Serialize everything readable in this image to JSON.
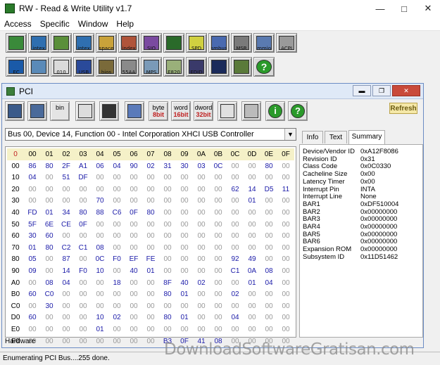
{
  "app": {
    "title": "RW - Read & Write Utility v1.7"
  },
  "menu": [
    "Access",
    "Specific",
    "Window",
    "Help"
  ],
  "toolbar_main": [
    {
      "label": "",
      "icon": "memory-chip-icon"
    },
    {
      "label": "intex",
      "icon": "intex-chip-icon"
    },
    {
      "label": "",
      "icon": "memory-module-icon"
    },
    {
      "label": "intex",
      "icon": "intex-memory-icon"
    },
    {
      "label": "space",
      "icon": "io-space-icon"
    },
    {
      "label": "index",
      "icon": "io-index-icon"
    },
    {
      "label": "SIO",
      "icon": "superio-icon"
    },
    {
      "label": "",
      "icon": "oscilloscope-icon"
    },
    {
      "label": "SPD",
      "icon": "spd-icon"
    },
    {
      "label": "smbus",
      "icon": "smbus-icon"
    },
    {
      "label": "MSR",
      "icon": "msr-icon"
    },
    {
      "label": "mmio",
      "icon": "mmio-icon"
    },
    {
      "label": "ACPI",
      "icon": "acpi-icon"
    },
    {
      "label": "EC",
      "icon": "ec-icon"
    },
    {
      "label": "",
      "icon": "disk-icon"
    },
    {
      "label": "010",
      "icon": "binary-icon"
    },
    {
      "label": "USB",
      "icon": "usb-icon"
    },
    {
      "label": "bios",
      "icon": "smbios-icon"
    },
    {
      "label": "55AA",
      "icon": "rom-icon"
    },
    {
      "label": "MPS",
      "icon": "mps-icon"
    },
    {
      "label": "E820",
      "icon": "e820-icon"
    },
    {
      "label": "EDID",
      "icon": "edid-icon"
    },
    {
      "label": "",
      "icon": "terminal-icon"
    },
    {
      "label": "",
      "icon": "phone-icon"
    },
    {
      "label": "",
      "icon": "help-icon"
    }
  ],
  "pci_window": {
    "title": "PCI",
    "refresh_label": "Refresh",
    "toolbar": [
      {
        "label": "",
        "icon": "save-icon"
      },
      {
        "label": "",
        "icon": "copy-icon"
      },
      {
        "label": "bin",
        "icon": "bin-icon"
      },
      {
        "label": "",
        "icon": "open-icon"
      },
      {
        "label": "",
        "icon": "binoculars-icon"
      },
      {
        "label": "",
        "icon": "grid-icon"
      },
      {
        "label": "byte 8bit",
        "icon": "byte-icon"
      },
      {
        "label": "word 16bit",
        "icon": "word-icon"
      },
      {
        "label": "dword 32bit",
        "icon": "dword-icon"
      },
      {
        "label": "",
        "icon": "list-icon"
      },
      {
        "label": "",
        "icon": "disc-icon"
      },
      {
        "label": "",
        "icon": "info-icon"
      },
      {
        "label": "",
        "icon": "help-icon"
      }
    ],
    "device": "Bus 00, Device 14, Function 00 - Intel Corporation XHCI USB Controller",
    "hex_header": [
      "0",
      "00",
      "01",
      "02",
      "03",
      "04",
      "05",
      "06",
      "07",
      "08",
      "09",
      "0A",
      "0B",
      "0C",
      "0D",
      "0E",
      "0F"
    ],
    "hex_rows": [
      {
        "addr": "00",
        "cells": [
          "86",
          "80",
          "2F",
          "A1",
          "06",
          "04",
          "90",
          "02",
          "31",
          "30",
          "03",
          "0C",
          "00",
          "00",
          "80",
          "00"
        ]
      },
      {
        "addr": "10",
        "cells": [
          "04",
          "00",
          "51",
          "DF",
          "00",
          "00",
          "00",
          "00",
          "00",
          "00",
          "00",
          "00",
          "00",
          "00",
          "00",
          "00"
        ]
      },
      {
        "addr": "20",
        "cells": [
          "00",
          "00",
          "00",
          "00",
          "00",
          "00",
          "00",
          "00",
          "00",
          "00",
          "00",
          "00",
          "62",
          "14",
          "D5",
          "11"
        ]
      },
      {
        "addr": "30",
        "cells": [
          "00",
          "00",
          "00",
          "00",
          "70",
          "00",
          "00",
          "00",
          "00",
          "00",
          "00",
          "00",
          "00",
          "01",
          "00",
          "00"
        ]
      },
      {
        "addr": "40",
        "cells": [
          "FD",
          "01",
          "34",
          "80",
          "88",
          "C6",
          "0F",
          "80",
          "00",
          "00",
          "00",
          "00",
          "00",
          "00",
          "00",
          "00"
        ]
      },
      {
        "addr": "50",
        "cells": [
          "5F",
          "6E",
          "CE",
          "0F",
          "00",
          "00",
          "00",
          "00",
          "00",
          "00",
          "00",
          "00",
          "00",
          "00",
          "00",
          "00"
        ]
      },
      {
        "addr": "60",
        "cells": [
          "30",
          "60",
          "00",
          "00",
          "00",
          "00",
          "00",
          "00",
          "00",
          "00",
          "00",
          "00",
          "00",
          "00",
          "00",
          "00"
        ]
      },
      {
        "addr": "70",
        "cells": [
          "01",
          "80",
          "C2",
          "C1",
          "08",
          "00",
          "00",
          "00",
          "00",
          "00",
          "00",
          "00",
          "00",
          "00",
          "00",
          "00"
        ]
      },
      {
        "addr": "80",
        "cells": [
          "05",
          "00",
          "87",
          "00",
          "0C",
          "F0",
          "EF",
          "FE",
          "00",
          "00",
          "00",
          "00",
          "92",
          "49",
          "00",
          "00"
        ]
      },
      {
        "addr": "90",
        "cells": [
          "09",
          "00",
          "14",
          "F0",
          "10",
          "00",
          "40",
          "01",
          "00",
          "00",
          "00",
          "00",
          "C1",
          "0A",
          "08",
          "00"
        ]
      },
      {
        "addr": "A0",
        "cells": [
          "00",
          "08",
          "04",
          "00",
          "00",
          "18",
          "00",
          "00",
          "8F",
          "40",
          "02",
          "00",
          "00",
          "01",
          "04",
          "00"
        ]
      },
      {
        "addr": "B0",
        "cells": [
          "60",
          "C0",
          "00",
          "00",
          "00",
          "00",
          "00",
          "00",
          "80",
          "01",
          "00",
          "00",
          "02",
          "00",
          "00",
          "00"
        ]
      },
      {
        "addr": "C0",
        "cells": [
          "00",
          "30",
          "00",
          "00",
          "00",
          "00",
          "00",
          "00",
          "00",
          "00",
          "00",
          "00",
          "00",
          "00",
          "00",
          "00"
        ]
      },
      {
        "addr": "D0",
        "cells": [
          "60",
          "00",
          "00",
          "00",
          "10",
          "02",
          "00",
          "00",
          "80",
          "01",
          "00",
          "00",
          "04",
          "00",
          "00",
          "00"
        ]
      },
      {
        "addr": "E0",
        "cells": [
          "00",
          "00",
          "00",
          "00",
          "01",
          "00",
          "00",
          "00",
          "00",
          "00",
          "00",
          "00",
          "00",
          "00",
          "00",
          "00"
        ]
      },
      {
        "addr": "F0",
        "cells": [
          "00",
          "00",
          "00",
          "00",
          "00",
          "00",
          "00",
          "00",
          "B3",
          "0F",
          "41",
          "08",
          "00",
          "00",
          "00",
          "00"
        ]
      }
    ],
    "tabs": [
      "Info",
      "Text",
      "Summary"
    ],
    "active_tab": "Summary",
    "summary": [
      {
        "k": "Device/Vendor ID",
        "v": "0xA12F8086"
      },
      {
        "k": "Revision ID",
        "v": "0x31"
      },
      {
        "k": "Class Code",
        "v": "0x0C0330"
      },
      {
        "k": "Cacheline Size",
        "v": "0x00"
      },
      {
        "k": "Latency Timer",
        "v": "0x00"
      },
      {
        "k": "Interrupt Pin",
        "v": "INTA"
      },
      {
        "k": "Interrupt Line",
        "v": "None"
      },
      {
        "k": "BAR1",
        "v": "0xDF510004"
      },
      {
        "k": "BAR2",
        "v": "0x00000000"
      },
      {
        "k": "BAR3",
        "v": "0x00000000"
      },
      {
        "k": "BAR4",
        "v": "0x00000000"
      },
      {
        "k": "BAR5",
        "v": "0x00000000"
      },
      {
        "k": "BAR6",
        "v": "0x00000000"
      },
      {
        "k": "Expansion ROM",
        "v": "0x00000000"
      },
      {
        "k": "Subsystem ID",
        "v": "0x11D51462"
      }
    ],
    "footer_label": "Hardware"
  },
  "status": "Enumerating PCI Bus....255 done.",
  "watermark": "DownloadSoftwareGratisan.com",
  "colors": {
    "hex_blue": "#1a1aa8",
    "hex_zero": "#999999",
    "accent": "#2a7a2a",
    "title_bg": "#dfe9f7"
  }
}
